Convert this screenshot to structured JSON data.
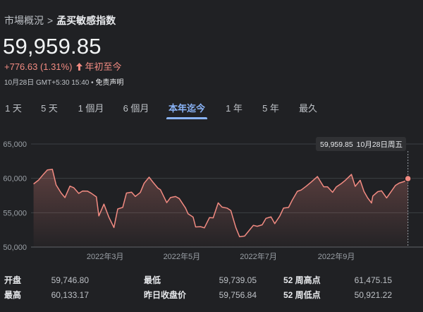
{
  "breadcrumb": {
    "parent": "市場概況",
    "separator": ">",
    "current": "孟买敏感指数"
  },
  "quote": {
    "price": "59,959.85",
    "change": "+776.63 (1.31%)",
    "change_arrow_icon": "arrow-up-icon",
    "change_period": "年初至今",
    "timestamp": "10月28日 GMT+5:30 15:40",
    "dot": "•",
    "disclaimer": "免责声明"
  },
  "tabs": [
    {
      "label": "1 天"
    },
    {
      "label": "5 天"
    },
    {
      "label": "1 個月"
    },
    {
      "label": "6 個月"
    },
    {
      "label": "本年迄今",
      "active": true
    },
    {
      "label": "1 年"
    },
    {
      "label": "5 年"
    },
    {
      "label": "最久"
    }
  ],
  "chart_data": {
    "type": "area",
    "x_axis_labels": [
      "2022年3月",
      "2022年5月",
      "2022年7月",
      "2022年9月"
    ],
    "y_tick_labels": [
      "65,000",
      "60,000",
      "55,000",
      "50,000"
    ],
    "ylim": [
      50000,
      65000
    ],
    "y_ticks": [
      65000,
      60000,
      55000,
      50000
    ],
    "x_ticks": [
      "2022-03-01",
      "2022-05-01",
      "2022-07-01",
      "2022-09-01"
    ],
    "tooltip": {
      "value": "59,959.85",
      "date": "10月28日周五"
    },
    "colors": {
      "line": "#f28b82",
      "fill_top": "#f28b82",
      "grid": "#3c4043",
      "axis_text": "#9aa0a6",
      "tooltip_bg": "#303134"
    },
    "points": [
      [
        "2022-01-03",
        59183
      ],
      [
        "2022-01-07",
        59745
      ],
      [
        "2022-01-11",
        60617
      ],
      [
        "2022-01-14",
        61223
      ],
      [
        "2022-01-18",
        61309
      ],
      [
        "2022-01-21",
        59037
      ],
      [
        "2022-01-25",
        57858
      ],
      [
        "2022-01-28",
        57200
      ],
      [
        "2022-02-01",
        58862
      ],
      [
        "2022-02-04",
        58645
      ],
      [
        "2022-02-08",
        57808
      ],
      [
        "2022-02-11",
        58153
      ],
      [
        "2022-02-15",
        58142
      ],
      [
        "2022-02-18",
        57833
      ],
      [
        "2022-02-22",
        57300
      ],
      [
        "2022-02-24",
        54530
      ],
      [
        "2022-02-28",
        56247
      ],
      [
        "2022-03-04",
        54334
      ],
      [
        "2022-03-08",
        52843
      ],
      [
        "2022-03-11",
        55550
      ],
      [
        "2022-03-15",
        55776
      ],
      [
        "2022-03-18",
        57863
      ],
      [
        "2022-03-22",
        57989
      ],
      [
        "2022-03-25",
        57362
      ],
      [
        "2022-03-29",
        57944
      ],
      [
        "2022-04-01",
        59277
      ],
      [
        "2022-04-05",
        60176
      ],
      [
        "2022-04-08",
        59447
      ],
      [
        "2022-04-12",
        58576
      ],
      [
        "2022-04-14",
        58339
      ],
      [
        "2022-04-19",
        56463
      ],
      [
        "2022-04-22",
        57197
      ],
      [
        "2022-04-26",
        57357
      ],
      [
        "2022-04-29",
        57061
      ],
      [
        "2022-05-04",
        55669
      ],
      [
        "2022-05-06",
        54836
      ],
      [
        "2022-05-10",
        54365
      ],
      [
        "2022-05-12",
        52931
      ],
      [
        "2022-05-16",
        52974
      ],
      [
        "2022-05-19",
        52792
      ],
      [
        "2022-05-23",
        54289
      ],
      [
        "2022-05-26",
        54253
      ],
      [
        "2022-05-30",
        56432
      ],
      [
        "2022-06-02",
        55818
      ],
      [
        "2022-06-06",
        55675
      ],
      [
        "2022-06-09",
        55320
      ],
      [
        "2022-06-13",
        52847
      ],
      [
        "2022-06-16",
        51496
      ],
      [
        "2022-06-20",
        51598
      ],
      [
        "2022-06-23",
        52266
      ],
      [
        "2022-06-27",
        53161
      ],
      [
        "2022-06-30",
        53018
      ],
      [
        "2022-07-04",
        53235
      ],
      [
        "2022-07-07",
        54178
      ],
      [
        "2022-07-11",
        54395
      ],
      [
        "2022-07-14",
        53416
      ],
      [
        "2022-07-18",
        54521
      ],
      [
        "2022-07-21",
        55682
      ],
      [
        "2022-07-25",
        55767
      ],
      [
        "2022-07-28",
        56858
      ],
      [
        "2022-08-01",
        58115
      ],
      [
        "2022-08-04",
        58298
      ],
      [
        "2022-08-08",
        58853
      ],
      [
        "2022-08-12",
        59463
      ],
      [
        "2022-08-17",
        60260
      ],
      [
        "2022-08-19",
        59646
      ],
      [
        "2022-08-22",
        58773
      ],
      [
        "2022-08-25",
        58774
      ],
      [
        "2022-08-29",
        57973
      ],
      [
        "2022-09-01",
        58766
      ],
      [
        "2022-09-05",
        59246
      ],
      [
        "2022-09-08",
        59688
      ],
      [
        "2022-09-13",
        60571
      ],
      [
        "2022-09-16",
        58840
      ],
      [
        "2022-09-20",
        59720
      ],
      [
        "2022-09-23",
        58099
      ],
      [
        "2022-09-26",
        57145
      ],
      [
        "2022-09-29",
        56410
      ],
      [
        "2022-09-30",
        57427
      ],
      [
        "2022-10-04",
        58065
      ],
      [
        "2022-10-07",
        58191
      ],
      [
        "2022-10-11",
        57147
      ],
      [
        "2022-10-14",
        57920
      ],
      [
        "2022-10-18",
        58960
      ],
      [
        "2022-10-21",
        59307
      ],
      [
        "2022-10-25",
        59543
      ],
      [
        "2022-10-28",
        59960
      ]
    ]
  },
  "stats": [
    {
      "label": "开盘",
      "value": "59,746.80"
    },
    {
      "label": "最高",
      "value": "60,133.17"
    },
    {
      "label": "最低",
      "value": "59,739.05"
    },
    {
      "label": "昨日收盘价",
      "value": "59,756.84"
    },
    {
      "label": "52 周高点",
      "value": "61,475.15"
    },
    {
      "label": "52 周低点",
      "value": "50,921.22"
    }
  ]
}
